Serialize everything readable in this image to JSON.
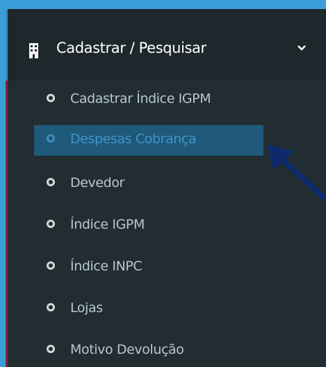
{
  "menu": {
    "header": {
      "label": "Cadastrar / Pesquisar",
      "icon": "building-icon",
      "chevron": "chevron-down-icon"
    },
    "items": [
      {
        "label": "Cadastrar Índice IGPM",
        "icon": "circle-outline-icon",
        "active": false
      },
      {
        "label": "Despesas Cobrança",
        "icon": "circle-outline-icon",
        "active": true
      },
      {
        "label": "Devedor",
        "icon": "circle-outline-icon",
        "active": false
      },
      {
        "label": "Índice IGPM",
        "icon": "circle-outline-icon",
        "active": false
      },
      {
        "label": "Índice INPC",
        "icon": "circle-outline-icon",
        "active": false
      },
      {
        "label": "Lojas",
        "icon": "circle-outline-icon",
        "active": false
      },
      {
        "label": "Motivo Devolução",
        "icon": "circle-outline-icon",
        "active": false
      }
    ]
  },
  "colors": {
    "background": "#3a9fd8",
    "sidebar": "#222d32",
    "header": "#1e282c",
    "active_bg": "#1f5a7a",
    "active_text": "#3f95c8",
    "annotation_arrow": "#0d2a6e"
  }
}
